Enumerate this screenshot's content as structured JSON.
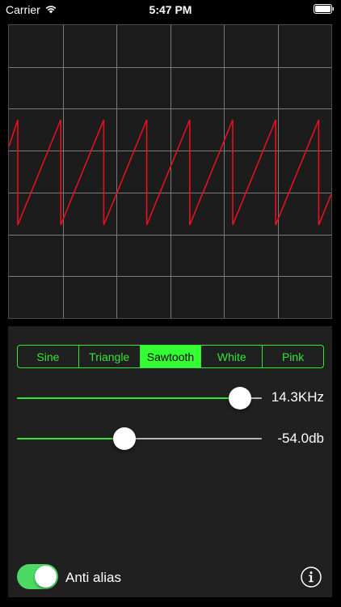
{
  "status_bar": {
    "carrier": "Carrier",
    "time": "5:47 PM",
    "wifi_icon": "wifi-icon",
    "battery_icon": "battery-icon"
  },
  "oscilloscope": {
    "background_color": "#1c1c1c",
    "grid_color": "#7a7a7a",
    "trace_color": "#e8101e",
    "waveform": "sawtooth",
    "grid_columns": 6,
    "grid_rows": 7
  },
  "waveform_selector": {
    "options": [
      "Sine",
      "Triangle",
      "Sawtooth",
      "White",
      "Pink"
    ],
    "selected": "Sawtooth",
    "accent_color": "#33e633"
  },
  "frequency_slider": {
    "value_text": "14.3KHz",
    "fraction": 0.91
  },
  "volume_slider": {
    "value_text": "-54.0db",
    "fraction": 0.44
  },
  "anti_alias": {
    "label": "Anti alias",
    "on": true,
    "on_color": "#4cd964"
  },
  "info_button": {
    "icon": "info-icon"
  }
}
